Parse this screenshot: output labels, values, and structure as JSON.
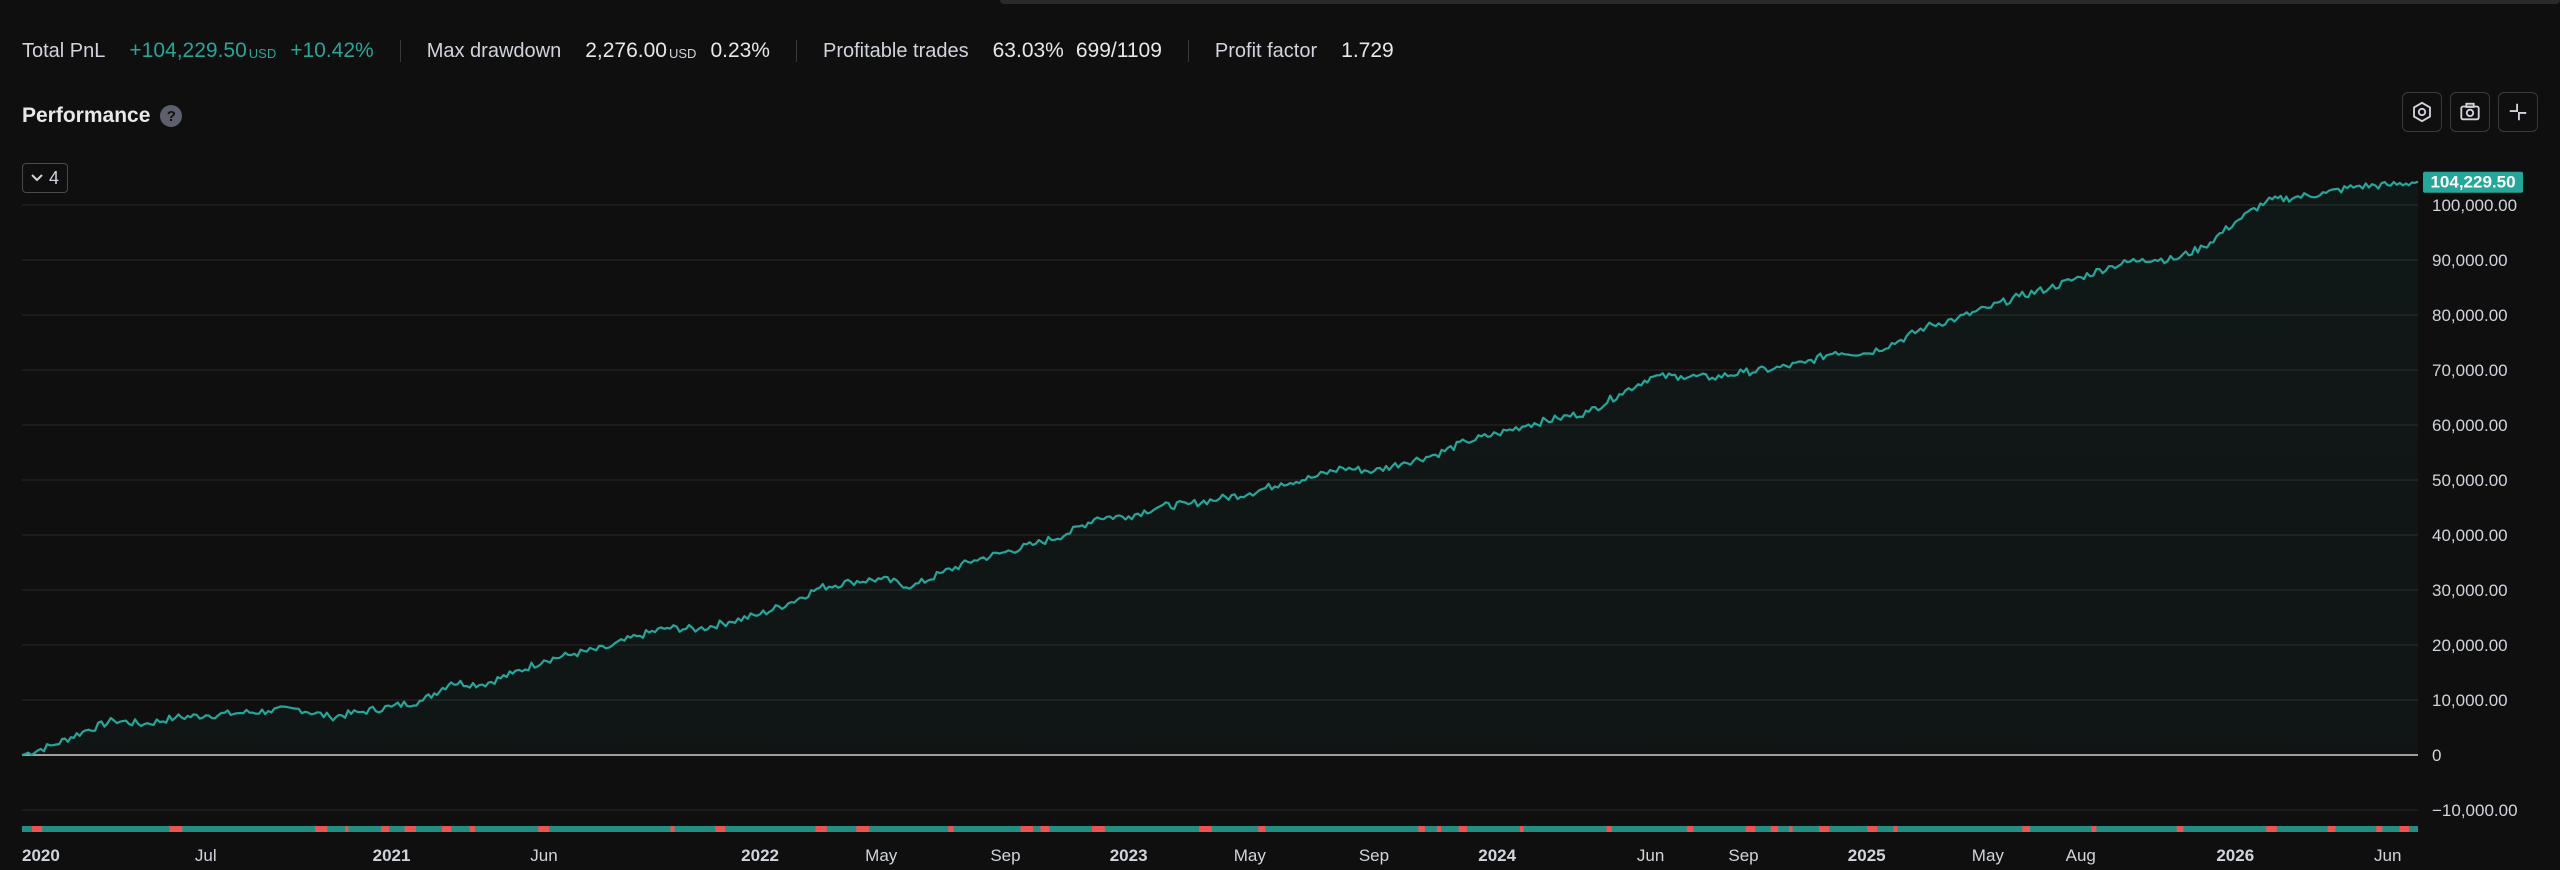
{
  "summary": {
    "total_pnl_label": "Total PnL",
    "total_pnl_value": "+104,229.50",
    "total_pnl_unit": "USD",
    "total_pnl_pct": "+10.42%",
    "max_drawdown_label": "Max drawdown",
    "max_drawdown_value": "2,276.00",
    "max_drawdown_unit": "USD",
    "max_drawdown_pct": "0.23%",
    "profitable_trades_label": "Profitable trades",
    "profitable_trades_pct": "63.03%",
    "profitable_trades_count": "699/1109",
    "profit_factor_label": "Profit factor",
    "profit_factor_value": "1.729"
  },
  "panel": {
    "title": "Performance",
    "help_icon": "?",
    "toggle_count": "4",
    "tool_icons": [
      "settings-icon",
      "camera-icon",
      "collapse-icon"
    ]
  },
  "colors": {
    "accent": "#26a69a",
    "negative": "#ef5350",
    "grid": "#2a2a2a",
    "zero_line": "#9e9e9e",
    "background": "#0f0f0f"
  },
  "chart_data": {
    "type": "area",
    "series": [
      {
        "points": [
          [
            "2020-01-01",
            0
          ],
          [
            "2020-02-01",
            1800
          ],
          [
            "2020-03-01",
            4200
          ],
          [
            "2020-04-01",
            6300
          ],
          [
            "2020-05-01",
            5600
          ],
          [
            "2020-06-01",
            6800
          ],
          [
            "2020-07-01",
            7200
          ],
          [
            "2020-08-01",
            7600
          ],
          [
            "2020-09-01",
            8000
          ],
          [
            "2020-10-01",
            8400
          ],
          [
            "2020-11-01",
            6900
          ],
          [
            "2020-12-01",
            7800
          ],
          [
            "2021-01-01",
            8800
          ],
          [
            "2021-02-01",
            9900
          ],
          [
            "2021-03-01",
            13200
          ],
          [
            "2021-04-01",
            12800
          ],
          [
            "2021-05-01",
            14800
          ],
          [
            "2021-06-01",
            17200
          ],
          [
            "2021-07-01",
            18400
          ],
          [
            "2021-08-01",
            19400
          ],
          [
            "2021-09-01",
            21600
          ],
          [
            "2021-10-01",
            23100
          ],
          [
            "2021-11-01",
            22900
          ],
          [
            "2021-12-01",
            24200
          ],
          [
            "2022-01-01",
            25600
          ],
          [
            "2022-02-01",
            27800
          ],
          [
            "2022-03-01",
            30400
          ],
          [
            "2022-04-01",
            31500
          ],
          [
            "2022-05-01",
            32000
          ],
          [
            "2022-06-01",
            30600
          ],
          [
            "2022-07-01",
            33200
          ],
          [
            "2022-08-01",
            35400
          ],
          [
            "2022-09-01",
            36900
          ],
          [
            "2022-10-01",
            38400
          ],
          [
            "2022-11-01",
            40200
          ],
          [
            "2022-12-01",
            43200
          ],
          [
            "2023-01-01",
            43400
          ],
          [
            "2023-02-01",
            45200
          ],
          [
            "2023-03-01",
            45600
          ],
          [
            "2023-04-01",
            46600
          ],
          [
            "2023-05-01",
            47600
          ],
          [
            "2023-06-01",
            49400
          ],
          [
            "2023-07-01",
            50400
          ],
          [
            "2023-08-01",
            52200
          ],
          [
            "2023-09-01",
            51600
          ],
          [
            "2023-10-01",
            53200
          ],
          [
            "2023-11-01",
            54600
          ],
          [
            "2023-12-01",
            57000
          ],
          [
            "2024-01-01",
            58400
          ],
          [
            "2024-02-01",
            60100
          ],
          [
            "2024-03-01",
            61200
          ],
          [
            "2024-04-01",
            62400
          ],
          [
            "2024-05-01",
            65600
          ],
          [
            "2024-06-01",
            68700
          ],
          [
            "2024-07-01",
            68900
          ],
          [
            "2024-08-01",
            68600
          ],
          [
            "2024-09-01",
            69600
          ],
          [
            "2024-10-01",
            70200
          ],
          [
            "2024-11-01",
            71300
          ],
          [
            "2024-12-01",
            73300
          ],
          [
            "2025-01-01",
            73000
          ],
          [
            "2025-02-01",
            75200
          ],
          [
            "2025-03-01",
            77900
          ],
          [
            "2025-04-01",
            79400
          ],
          [
            "2025-05-01",
            81300
          ],
          [
            "2025-06-01",
            83400
          ],
          [
            "2025-07-01",
            84900
          ],
          [
            "2025-08-01",
            86900
          ],
          [
            "2025-09-01",
            88900
          ],
          [
            "2025-10-01",
            90200
          ],
          [
            "2025-11-01",
            90100
          ],
          [
            "2025-12-01",
            92400
          ],
          [
            "2026-01-01",
            96900
          ],
          [
            "2026-02-01",
            100700
          ],
          [
            "2026-03-01",
            101400
          ],
          [
            "2026-04-01",
            102200
          ],
          [
            "2026-05-01",
            103400
          ],
          [
            "2026-06-01",
            103600
          ],
          [
            "2026-07-01",
            104229.5
          ]
        ]
      }
    ],
    "last_value_label": "104,229.50",
    "y_ticks": [
      {
        "value": 100000,
        "label": "100,000.00"
      },
      {
        "value": 90000,
        "label": "90,000.00"
      },
      {
        "value": 80000,
        "label": "80,000.00"
      },
      {
        "value": 70000,
        "label": "70,000.00"
      },
      {
        "value": 60000,
        "label": "60,000.00"
      },
      {
        "value": 50000,
        "label": "50,000.00"
      },
      {
        "value": 40000,
        "label": "40,000.00"
      },
      {
        "value": 30000,
        "label": "30,000.00"
      },
      {
        "value": 20000,
        "label": "20,000.00"
      },
      {
        "value": 10000,
        "label": "10,000.00"
      },
      {
        "value": 0,
        "label": "0"
      },
      {
        "value": -10000,
        "label": "−10,000.00"
      }
    ],
    "x_ticks": [
      {
        "date": "2020-01-01",
        "label": "2020",
        "year": true
      },
      {
        "date": "2020-07-01",
        "label": "Jul",
        "year": false
      },
      {
        "date": "2021-01-01",
        "label": "2021",
        "year": true
      },
      {
        "date": "2021-06-01",
        "label": "Jun",
        "year": false
      },
      {
        "date": "2022-01-01",
        "label": "2022",
        "year": true
      },
      {
        "date": "2022-05-01",
        "label": "May",
        "year": false
      },
      {
        "date": "2022-09-01",
        "label": "Sep",
        "year": false
      },
      {
        "date": "2023-01-01",
        "label": "2023",
        "year": true
      },
      {
        "date": "2023-05-01",
        "label": "May",
        "year": false
      },
      {
        "date": "2023-09-01",
        "label": "Sep",
        "year": false
      },
      {
        "date": "2024-01-01",
        "label": "2024",
        "year": true
      },
      {
        "date": "2024-06-01",
        "label": "Jun",
        "year": false
      },
      {
        "date": "2024-09-01",
        "label": "Sep",
        "year": false
      },
      {
        "date": "2025-01-01",
        "label": "2025",
        "year": true
      },
      {
        "date": "2025-05-01",
        "label": "May",
        "year": false
      },
      {
        "date": "2025-08-01",
        "label": "Aug",
        "year": false
      },
      {
        "date": "2026-01-01",
        "label": "2026",
        "year": true
      },
      {
        "date": "2026-06-01",
        "label": "Jun",
        "year": false
      }
    ],
    "ylim": [
      -10000,
      104229.5
    ],
    "xlim": [
      "2020-01-01",
      "2026-07-01"
    ],
    "grid": true,
    "legend": "none"
  }
}
